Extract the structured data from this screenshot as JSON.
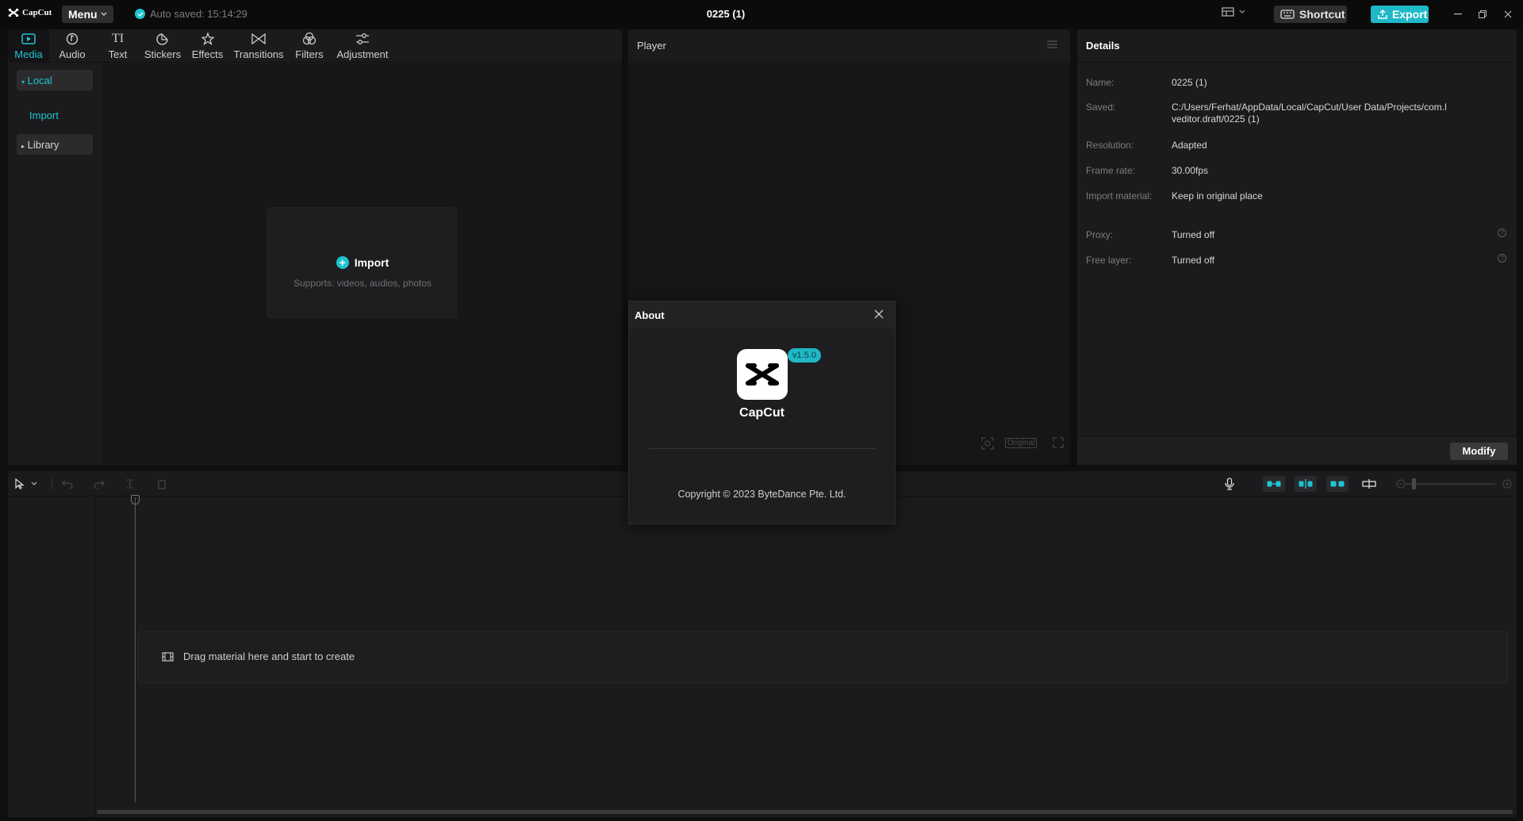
{
  "titlebar": {
    "logo_text": "CapCut",
    "menu_label": "Menu",
    "autosave_text": "Auto saved: 15:14:29",
    "project_title": "0225 (1)",
    "shortcut_label": "Shortcut",
    "export_label": "Export"
  },
  "media": {
    "tabs": [
      {
        "label": "Media",
        "icon": "media-icon"
      },
      {
        "label": "Audio",
        "icon": "audio-icon"
      },
      {
        "label": "Text",
        "icon": "text-icon"
      },
      {
        "label": "Stickers",
        "icon": "stickers-icon"
      },
      {
        "label": "Effects",
        "icon": "effects-icon"
      },
      {
        "label": "Transitions",
        "icon": "transitions-icon"
      },
      {
        "label": "Filters",
        "icon": "filters-icon"
      },
      {
        "label": "Adjustment",
        "icon": "adjustment-icon"
      }
    ],
    "sidebar": {
      "local": "Local",
      "import": "Import",
      "library": "Library"
    },
    "import_card": {
      "title": "Import",
      "subtitle": "Supports: videos, audios, photos"
    }
  },
  "player": {
    "title": "Player",
    "original_label": "Original"
  },
  "details": {
    "title": "Details",
    "rows": [
      {
        "label": "Name:",
        "value": "0225 (1)"
      },
      {
        "label": "Saved:",
        "value": "C:/Users/Ferhat/AppData/Local/CapCut/User Data/Projects/com.lveditor.draft/0225 (1)"
      },
      {
        "label": "Resolution:",
        "value": "Adapted"
      },
      {
        "label": "Frame rate:",
        "value": "30.00fps"
      },
      {
        "label": "Import material:",
        "value": "Keep in original place"
      },
      {
        "label": "Proxy:",
        "value": "Turned off"
      },
      {
        "label": "Free layer:",
        "value": "Turned off"
      }
    ],
    "modify_label": "Modify"
  },
  "timeline": {
    "drop_text": "Drag material here and start to create"
  },
  "about": {
    "title": "About",
    "version": "v1.5.0",
    "app_name": "CapCut",
    "copyright": "Copyright © 2023 ByteDance Pte. Ltd."
  },
  "colors": {
    "accent": "#20c3cf",
    "export": "#1fb8c6",
    "background": "#0f0f10",
    "panel": "#1b1b1d"
  }
}
